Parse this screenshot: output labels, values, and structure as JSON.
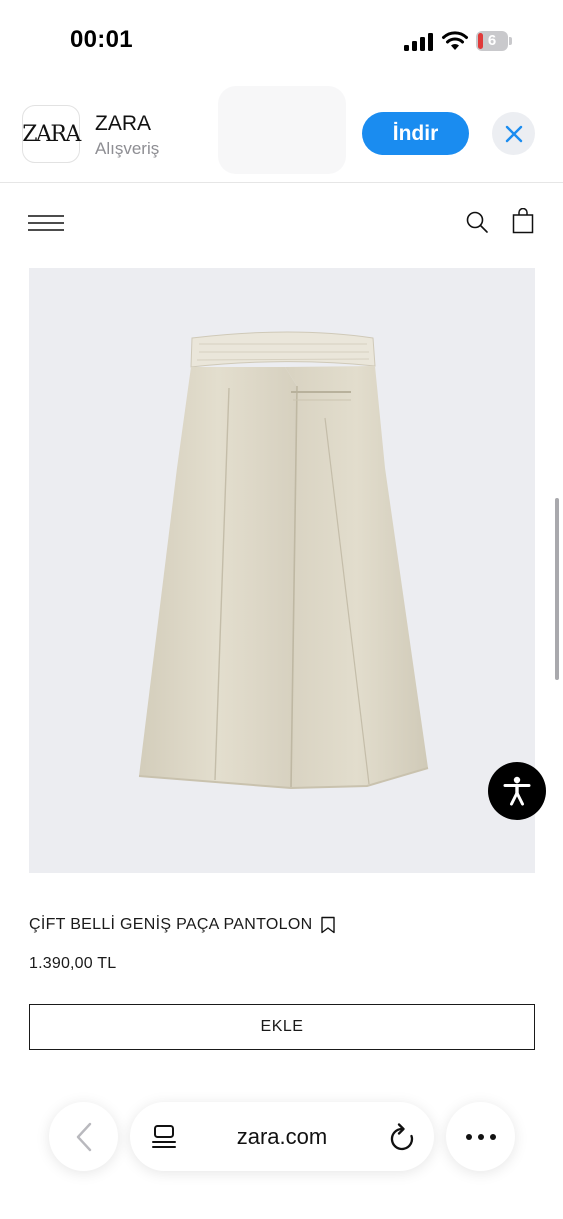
{
  "status_bar": {
    "time": "00:01",
    "battery_level": "6",
    "icons": [
      "cellular-signal-icon",
      "wifi-icon",
      "battery-icon"
    ]
  },
  "app_banner": {
    "app_icon_text": "ZARA",
    "app_name": "ZARA",
    "app_category": "Alışveriş",
    "get_button_label": "İndir",
    "close_icon": "close-icon"
  },
  "site_header": {
    "icons": [
      "menu-icon",
      "search-icon",
      "shopping-bag-icon"
    ]
  },
  "product": {
    "image_subject": "beige wide-leg trousers",
    "name": "ÇİFT BELLİ GENİŞ PAÇA PANTOLON",
    "price": "1.390,00 TL",
    "add_button_label": "EKLE",
    "bookmark_icon": "bookmark-icon"
  },
  "browser_bar": {
    "url": "zara.com",
    "icons": [
      "back-chevron-icon",
      "tabs-icon",
      "reload-icon",
      "more-dots-icon"
    ]
  },
  "colors": {
    "accent_blue": "#1a8cf0",
    "image_background": "#ecedf1",
    "product_beige": "#ddd8c8",
    "text_dark": "#1a1a1a"
  }
}
